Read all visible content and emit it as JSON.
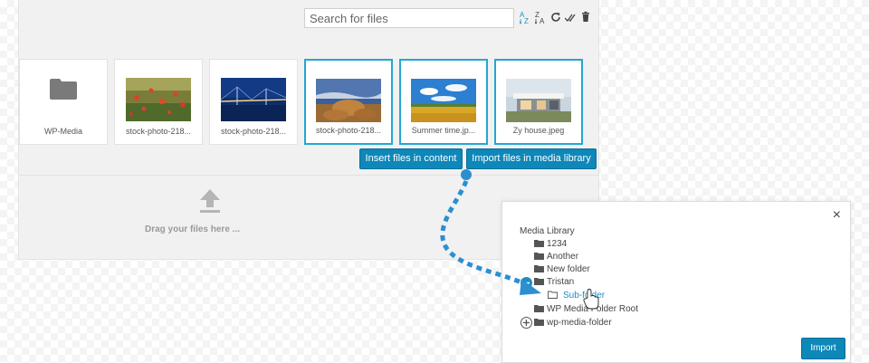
{
  "toolbar": {
    "search_placeholder": "Search for files",
    "icons": [
      "sort-az-icon",
      "sort-za-icon",
      "refresh-icon",
      "select-all-icon",
      "trash-icon"
    ]
  },
  "files": [
    {
      "label": "WP-Media",
      "type": "folder",
      "selected": false
    },
    {
      "label": "stock-photo-218...",
      "type": "image",
      "icon": "poppies-image",
      "selected": false
    },
    {
      "label": "stock-photo-218...",
      "type": "image",
      "icon": "bridge-image",
      "selected": false
    },
    {
      "label": "stock-photo-218...",
      "type": "image",
      "icon": "rocks-image",
      "selected": true
    },
    {
      "label": "Summer time.jp...",
      "type": "image",
      "icon": "field-image",
      "selected": true
    },
    {
      "label": "Zy house.jpeg",
      "type": "image",
      "icon": "house-image",
      "selected": true
    }
  ],
  "actions": {
    "insert_label": "Insert files in content",
    "import_label": "Import files in media library"
  },
  "dropzone": {
    "text": "Drag your files here ..."
  },
  "dialog": {
    "close": "×",
    "root": "Media Library",
    "folders": [
      {
        "name": "1234"
      },
      {
        "name": "Another"
      },
      {
        "name": "New folder"
      },
      {
        "name": "Tristan",
        "expanded": true
      },
      {
        "name": "Sub-folder",
        "child": true,
        "active": true
      },
      {
        "name": "WP Media Folder Root"
      },
      {
        "name": "wp-media-folder",
        "collapsed": true
      }
    ],
    "import_label": "Import"
  },
  "colors": {
    "accent": "#0e87b9",
    "selected_border": "#22a7d4",
    "arrow": "#2b8fd0"
  }
}
